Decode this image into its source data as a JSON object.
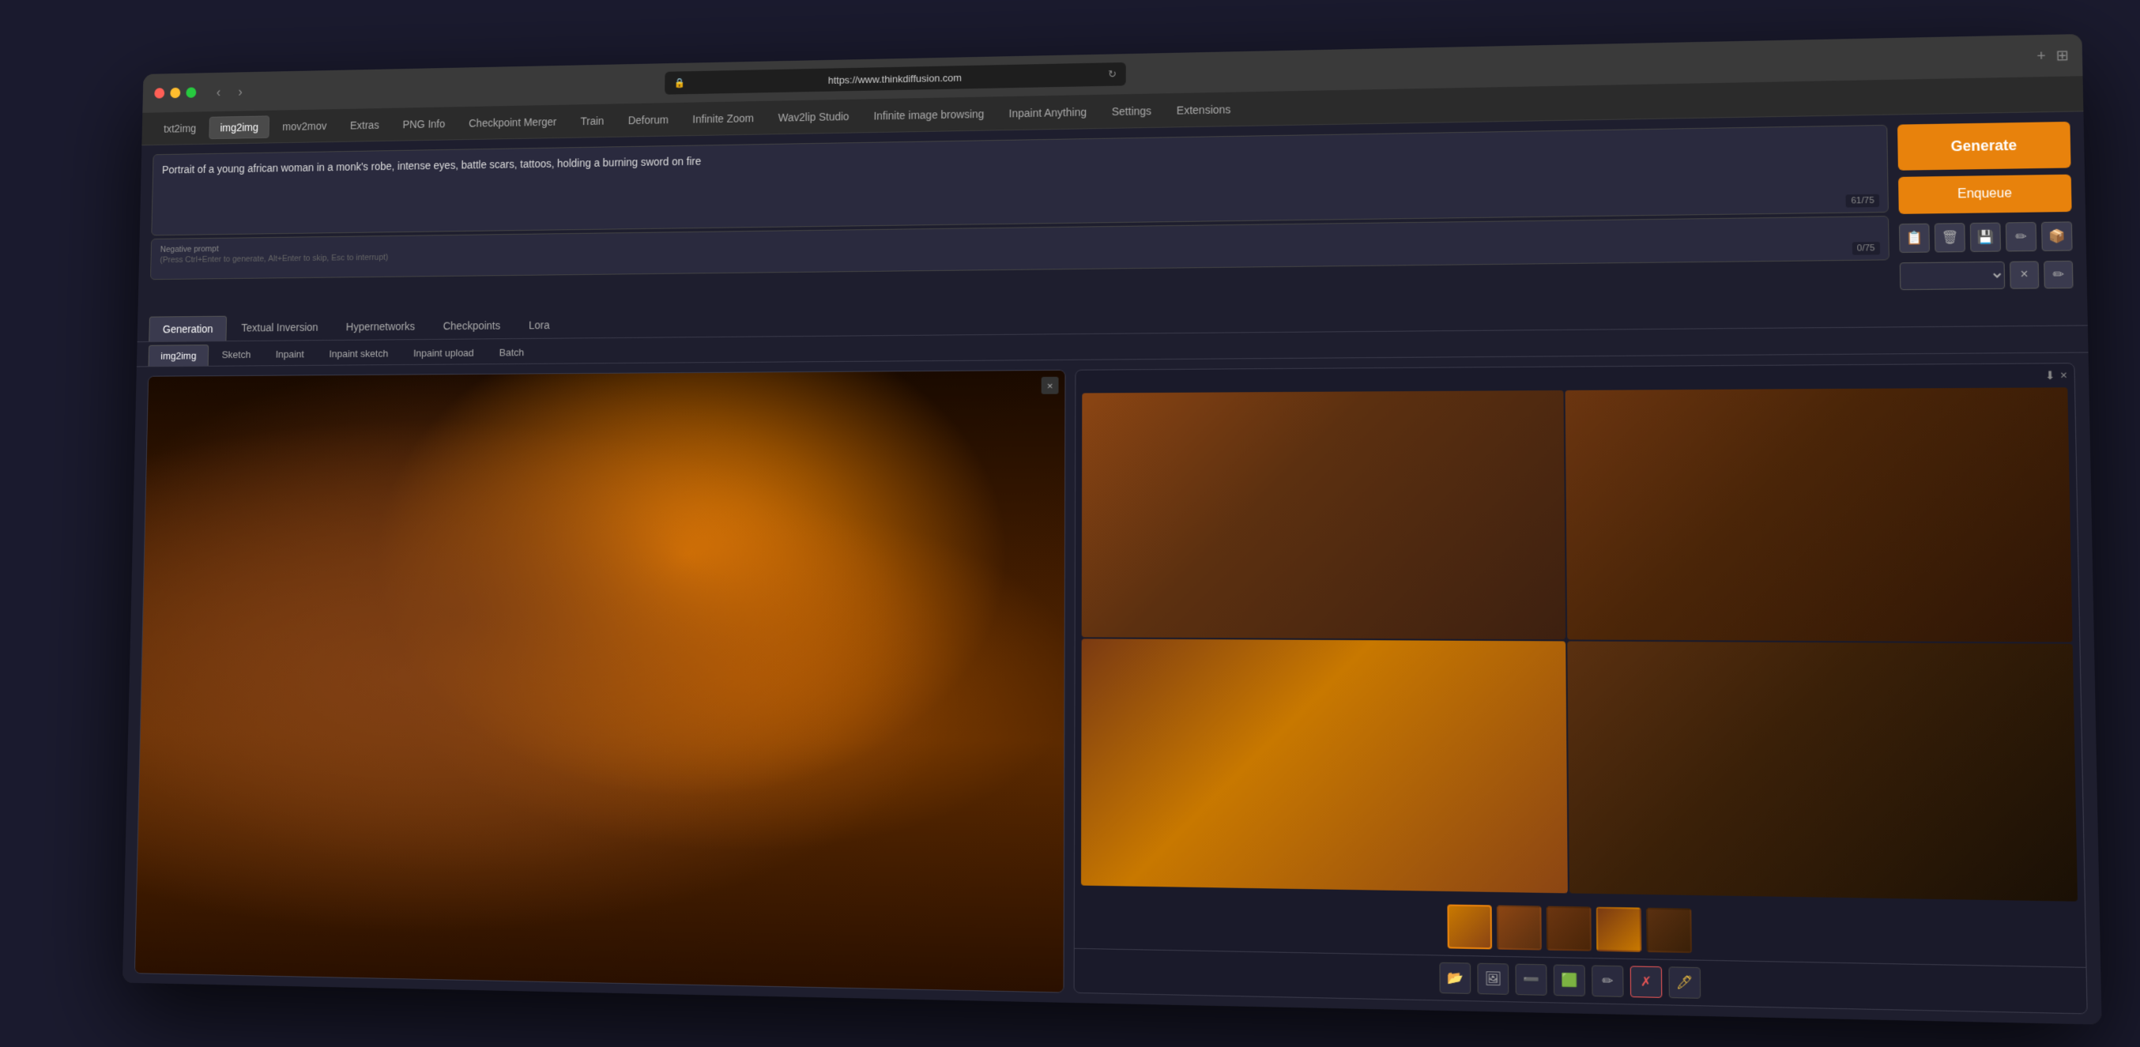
{
  "browser": {
    "url": "https://www.thinkdiffusion.com",
    "reload_icon": "↻",
    "back_icon": "‹",
    "forward_icon": "›",
    "plus_icon": "+",
    "grid_icon": "⊞"
  },
  "nav_tabs": [
    {
      "id": "txt2img",
      "label": "txt2img",
      "active": false
    },
    {
      "id": "img2img",
      "label": "img2img",
      "active": true
    },
    {
      "id": "mov2mov",
      "label": "mov2mov",
      "active": false
    },
    {
      "id": "extras",
      "label": "Extras",
      "active": false
    },
    {
      "id": "png_info",
      "label": "PNG Info",
      "active": false
    },
    {
      "id": "checkpoint_merger",
      "label": "Checkpoint Merger",
      "active": false
    },
    {
      "id": "train",
      "label": "Train",
      "active": false
    },
    {
      "id": "deforum",
      "label": "Deforum",
      "active": false
    },
    {
      "id": "infinite_zoom",
      "label": "Infinite Zoom",
      "active": false
    },
    {
      "id": "wav2lip",
      "label": "Wav2lip Studio",
      "active": false
    },
    {
      "id": "infinite_browse",
      "label": "Infinite image browsing",
      "active": false
    },
    {
      "id": "inpaint_anything",
      "label": "Inpaint Anything",
      "active": false
    },
    {
      "id": "settings",
      "label": "Settings",
      "active": false
    },
    {
      "id": "extensions",
      "label": "Extensions",
      "active": false
    }
  ],
  "prompt": {
    "positive_text": "Portrait of a young african woman in a monk's robe, intense eyes, battle scars, tattoos, holding a burning sword on fire",
    "positive_token_count": "61/75",
    "negative_placeholder": "Negative prompt",
    "negative_hint": "(Press Ctrl+Enter to generate, Alt+Enter to skip, Esc to interrupt)",
    "negative_token_count": "0/75"
  },
  "buttons": {
    "generate": "Generate",
    "enqueue": "Enqueue"
  },
  "icon_buttons": {
    "paste": "📋",
    "clear_pos": "🗑",
    "save": "💾",
    "edit": "✏",
    "extra": "📦"
  },
  "section_tabs": [
    {
      "id": "generation",
      "label": "Generation",
      "active": true
    },
    {
      "id": "textual_inversion",
      "label": "Textual Inversion",
      "active": false
    },
    {
      "id": "hypernetworks",
      "label": "Hypernetworks",
      "active": false
    },
    {
      "id": "checkpoints",
      "label": "Checkpoints",
      "active": false
    },
    {
      "id": "lora",
      "label": "Lora",
      "active": false
    }
  ],
  "sub_tabs": [
    {
      "id": "img2img",
      "label": "img2img",
      "active": true
    },
    {
      "id": "sketch",
      "label": "Sketch",
      "active": false
    },
    {
      "id": "inpaint",
      "label": "Inpaint",
      "active": false
    },
    {
      "id": "inpaint_sketch",
      "label": "Inpaint sketch",
      "active": false
    },
    {
      "id": "inpaint_upload",
      "label": "Inpaint upload",
      "active": false
    },
    {
      "id": "batch",
      "label": "Batch",
      "active": false
    }
  ],
  "image_panel": {
    "close_symbol": "×",
    "download_icon": "⬇",
    "close_right_icon": "×"
  },
  "toolbar_icons": [
    "📂",
    "🖼",
    "➖",
    "🟩",
    "✏",
    "✗",
    "🖊"
  ],
  "colors": {
    "accent": "#e8820c",
    "bg_dark": "#1e1e2e",
    "bg_medium": "#2b2b2b",
    "tab_active": "#3a3a4e",
    "border": "#444"
  }
}
